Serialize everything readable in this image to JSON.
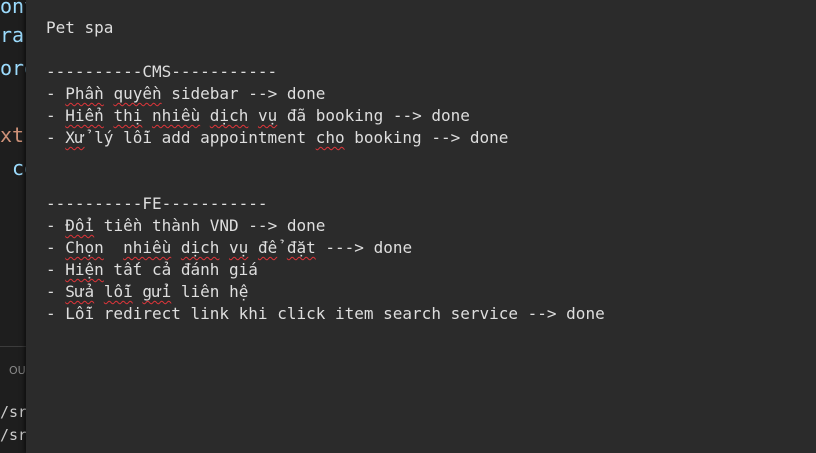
{
  "background_editor": {
    "code_fragments": [
      {
        "text": "onti",
        "color": "#9cdcfe"
      },
      {
        "text": "ran",
        "color": "#9cdcfe"
      },
      {
        "text": "oro",
        "color": "#9cdcfe"
      },
      {
        "text": "xt-",
        "color": "#ce9178"
      },
      {
        "text": " co",
        "color": "#9cdcfe"
      }
    ],
    "panel_label": "OU",
    "terminal_fragments": [
      "/sro",
      "/sro"
    ]
  },
  "note": {
    "lines": [
      [
        {
          "t": "Pet spa"
        }
      ],
      [
        {
          "t": ""
        }
      ],
      [
        {
          "t": "----------CMS-----------"
        }
      ],
      [
        {
          "t": "- "
        },
        {
          "t": "Phần",
          "sq": true
        },
        {
          "t": " "
        },
        {
          "t": "quyền",
          "sq": true
        },
        {
          "t": " sidebar --> done"
        }
      ],
      [
        {
          "t": "- "
        },
        {
          "t": "Hiển",
          "sq": true
        },
        {
          "t": " "
        },
        {
          "t": "thị",
          "sq": true
        },
        {
          "t": " "
        },
        {
          "t": "nhiều",
          "sq": true
        },
        {
          "t": " "
        },
        {
          "t": "dịch",
          "sq": true
        },
        {
          "t": " "
        },
        {
          "t": "vụ",
          "sq": true
        },
        {
          "t": " đã booking --> done"
        }
      ],
      [
        {
          "t": "- "
        },
        {
          "t": "Xử",
          "sq": true
        },
        {
          "t": " lý lỗi add appointment "
        },
        {
          "t": "cho",
          "sq": true
        },
        {
          "t": " booking --> done"
        }
      ],
      [
        {
          "t": ""
        }
      ],
      [
        {
          "t": ""
        }
      ],
      [
        {
          "t": "----------FE-----------"
        }
      ],
      [
        {
          "t": "- "
        },
        {
          "t": "Đổi",
          "sq": true
        },
        {
          "t": " tiền thành VND --> done"
        }
      ],
      [
        {
          "t": "- "
        },
        {
          "t": "Chọn",
          "sq": true
        },
        {
          "t": "  "
        },
        {
          "t": "nhiều",
          "sq": true
        },
        {
          "t": " "
        },
        {
          "t": "dịch",
          "sq": true
        },
        {
          "t": " "
        },
        {
          "t": "vụ",
          "sq": true
        },
        {
          "t": " "
        },
        {
          "t": "để",
          "sq": true
        },
        {
          "t": " "
        },
        {
          "t": "đặt",
          "sq": true
        },
        {
          "t": " ---> done"
        }
      ],
      [
        {
          "t": "- "
        },
        {
          "t": "Hiện",
          "sq": true
        },
        {
          "t": " tất cả đánh giá"
        }
      ],
      [
        {
          "t": "- "
        },
        {
          "t": "Sửa",
          "sq": true
        },
        {
          "t": " "
        },
        {
          "t": "lỗi",
          "sq": true
        },
        {
          "t": " "
        },
        {
          "t": "gửi",
          "sq": true
        },
        {
          "t": " liên hệ"
        }
      ],
      [
        {
          "t": "- Lỗi redirect link khi click item search service --> done"
        }
      ]
    ]
  },
  "colors": {
    "note_background": "#2b2b2b",
    "editor_background": "#1e1e1e",
    "text": "#dedede",
    "spellcheck_squiggle": "#e0353a"
  }
}
